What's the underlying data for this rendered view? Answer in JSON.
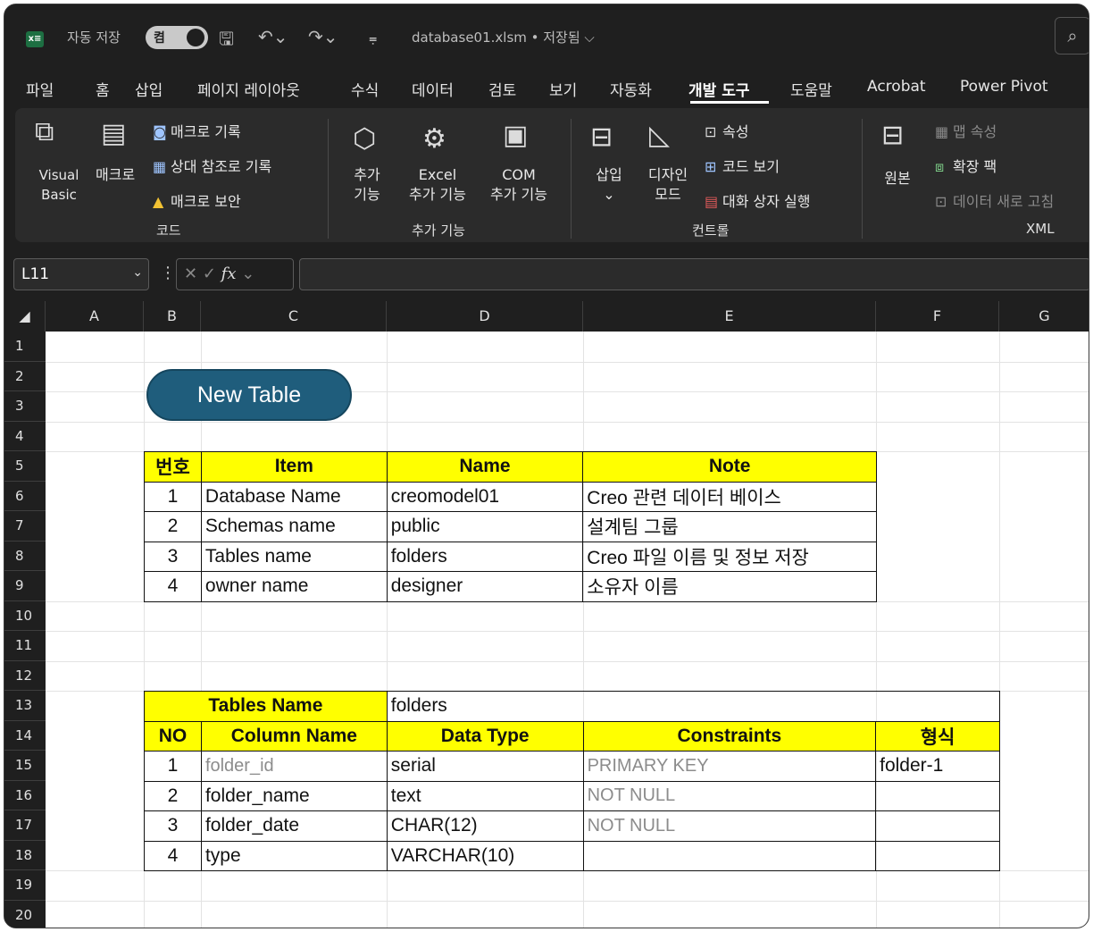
{
  "titlebar": {
    "autosave_label": "자동 저장",
    "toggle_label": "켬",
    "filename": "database01.xlsm • 저장됨 ⌵"
  },
  "menu": {
    "items": [
      "파일",
      "홈",
      "삽입",
      "페이지 레이아웃",
      "수식",
      "데이터",
      "검토",
      "보기",
      "자동화",
      "개발 도구",
      "도움말",
      "Acrobat",
      "Power Pivot"
    ],
    "active": "개발 도구"
  },
  "ribbon": {
    "code": {
      "visual_basic": "Visual\nBasic",
      "macro": "매크로",
      "record_macro": "매크로 기록",
      "relative_ref": "상대 참조로 기록",
      "macro_security": "매크로 보안",
      "group": "코드"
    },
    "addins": {
      "addins": "추가\n기능",
      "excel_addins": "Excel\n추가 기능",
      "com_addins": "COM\n추가 기능",
      "group": "추가 기능"
    },
    "controls": {
      "insert": "삽입",
      "design_mode": "디자인\n모드",
      "properties": "속성",
      "view_code": "코드 보기",
      "run_dialog": "대화 상자 실행",
      "group": "컨트롤"
    },
    "xml": {
      "source": "원본",
      "map_properties": "맵 속성",
      "expansion_packs": "확장 팩",
      "refresh_data": "데이터 새로 고침",
      "group": "XML"
    }
  },
  "formula_bar": {
    "cell_ref": "L11",
    "formula": ""
  },
  "grid": {
    "columns": [
      "A",
      "B",
      "C",
      "D",
      "E",
      "F",
      "G"
    ],
    "rows": [
      "1",
      "2",
      "3",
      "4",
      "5",
      "6",
      "7",
      "8",
      "9",
      "10",
      "11",
      "12",
      "13",
      "14",
      "15",
      "16",
      "17",
      "18",
      "19",
      "20"
    ]
  },
  "new_table_button": "New Table",
  "table1": {
    "headers": [
      "번호",
      "Item",
      "Name",
      "Note"
    ],
    "rows": [
      [
        "1",
        "Database Name",
        "creomodel01",
        "Creo 관련 데이터 베이스"
      ],
      [
        "2",
        "Schemas name",
        "public",
        "설계팀 그룹"
      ],
      [
        "3",
        "Tables name",
        "folders",
        "Creo 파일 이름 및 정보 저장"
      ],
      [
        "4",
        "owner name",
        "designer",
        "소유자 이름"
      ]
    ]
  },
  "table2": {
    "tables_name_label": "Tables Name",
    "tables_name_value": "folders",
    "headers": [
      "NO",
      "Column Name",
      "Data Type",
      "Constraints",
      "형식"
    ],
    "rows": [
      [
        "1",
        "folder_id",
        "serial",
        "PRIMARY KEY",
        "folder-1"
      ],
      [
        "2",
        "folder_name",
        "text",
        "NOT NULL",
        ""
      ],
      [
        "3",
        "folder_date",
        "CHAR(12)",
        "NOT NULL",
        ""
      ],
      [
        "4",
        "type",
        "VARCHAR(10)",
        "",
        ""
      ]
    ]
  }
}
